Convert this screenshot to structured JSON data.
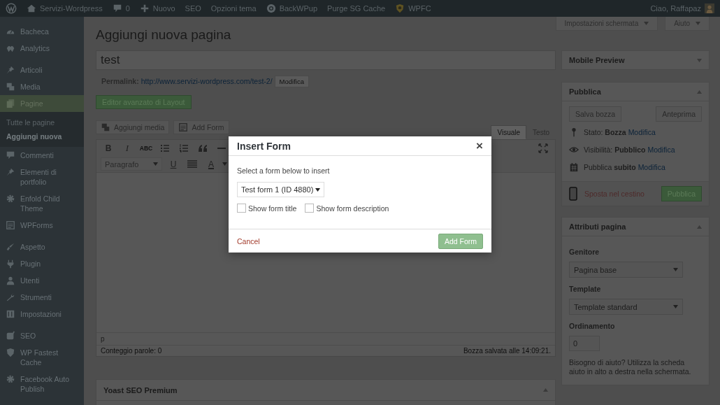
{
  "admin_bar": {
    "items": [
      {
        "kind": "home",
        "label": "Servizi-Wordpress"
      },
      {
        "kind": "comments",
        "label": "0"
      },
      {
        "kind": "new",
        "label": "Nuovo"
      },
      {
        "kind": "plain",
        "label": "SEO"
      },
      {
        "kind": "plain",
        "label": "Opzioni tema"
      },
      {
        "kind": "backup",
        "label": "BackWPup"
      },
      {
        "kind": "plain",
        "label": "Purge SG Cache"
      },
      {
        "kind": "shield",
        "label": "WPFC"
      }
    ],
    "greeting": "Ciao, Raffapaz"
  },
  "sidebar": {
    "groups": [
      [
        {
          "kind": "gauge",
          "label": "Bacheca",
          "selected": false
        },
        {
          "kind": "analytics",
          "label": "Analytics",
          "selected": false
        }
      ],
      [
        {
          "kind": "pin",
          "label": "Articoli",
          "selected": false
        },
        {
          "kind": "media",
          "label": "Media",
          "selected": false
        },
        {
          "kind": "pages",
          "label": "Pagine",
          "selected": true,
          "children": [
            {
              "label": "Tutte le pagine",
              "selected": false
            },
            {
              "label": "Aggiungi nuova",
              "selected": true
            }
          ]
        },
        {
          "kind": "comment",
          "label": "Commenti",
          "selected": false
        },
        {
          "kind": "pin",
          "label": "Elementi di portfolio",
          "selected": false
        },
        {
          "kind": "gear",
          "label": "Enfold Child Theme",
          "selected": false
        },
        {
          "kind": "form",
          "label": "WPForms",
          "selected": false
        }
      ],
      [
        {
          "kind": "brush",
          "label": "Aspetto",
          "selected": false
        },
        {
          "kind": "plug",
          "label": "Plugin",
          "selected": false
        },
        {
          "kind": "user",
          "label": "Utenti",
          "selected": false
        },
        {
          "kind": "wrench",
          "label": "Strumenti",
          "selected": false
        },
        {
          "kind": "sliders",
          "label": "Impostazioni",
          "selected": false
        }
      ],
      [
        {
          "kind": "yoast",
          "label": "SEO",
          "selected": false
        },
        {
          "kind": "shield",
          "label": "WP Fastest Cache",
          "selected": false
        },
        {
          "kind": "gear",
          "label": "Facebook Auto Publish",
          "selected": false
        }
      ]
    ]
  },
  "screen_tabs": [
    "Impostazioni schermata",
    "Aiuto"
  ],
  "page_title": "Aggiungi nuova pagina",
  "title_field": {
    "value": "test"
  },
  "permalink": {
    "label": "Permalink:",
    "url": "http://www.servizi-wordpress.com/test-2/",
    "button": "Modifica"
  },
  "layout_button": "Editor avanzato di Layout",
  "media_buttons": [
    {
      "kind": "media",
      "label": "Aggiungi media"
    },
    {
      "kind": "form",
      "label": "Add Form"
    }
  ],
  "editor_tabs": [
    {
      "label": "Visuale",
      "selected": true
    },
    {
      "label": "Testo",
      "selected": false
    }
  ],
  "toolbar": {
    "bold": "B",
    "italic": "I",
    "strike": "ABC",
    "format": "Paragrafo",
    "underline": "U",
    "text_color": "A"
  },
  "editor_footer": {
    "path": "p",
    "word_count": "Conteggio parole: 0",
    "saved": "Bozza salvata alle 14:09:21."
  },
  "yoast": {
    "title": "Yoast SEO Premium",
    "expanded": true
  },
  "mobile_preview": {
    "title": "Mobile Preview",
    "expanded": false
  },
  "publish": {
    "title": "Pubblica",
    "expanded": true,
    "save_draft": "Salva bozza",
    "preview": "Anteprima",
    "rows": [
      {
        "kind": "pin",
        "text": "Stato: **Bozza**",
        "link": "Modifica"
      },
      {
        "kind": "eye",
        "text": "Visibilità: **Pubblico**",
        "link": "Modifica"
      },
      {
        "kind": "calendar",
        "text": "Pubblica **subito**",
        "link": "Modifica"
      }
    ],
    "trash": "Sposta nel cestino",
    "publish": "Pubblica"
  },
  "page_attributes": {
    "title": "Attributi pagina",
    "expanded": true,
    "parent_label": "Genitore",
    "parent": "Pagina base",
    "template_label": "Template",
    "template": "Template standard",
    "order_label": "Ordinamento",
    "order": "0",
    "help": "Bisogno di aiuto? Utilizza la scheda aiuto in alto a destra nella schermata."
  },
  "dialog": {
    "title": "Insert Form",
    "close": "×",
    "prompt": "Select a form below to insert",
    "form": "Test form 1 (ID 4880)",
    "options": [
      {
        "label": "Show form title",
        "checked": false
      },
      {
        "label": "Show form description",
        "checked": false
      }
    ],
    "cancel": "Cancel",
    "submit": "Add Form"
  }
}
